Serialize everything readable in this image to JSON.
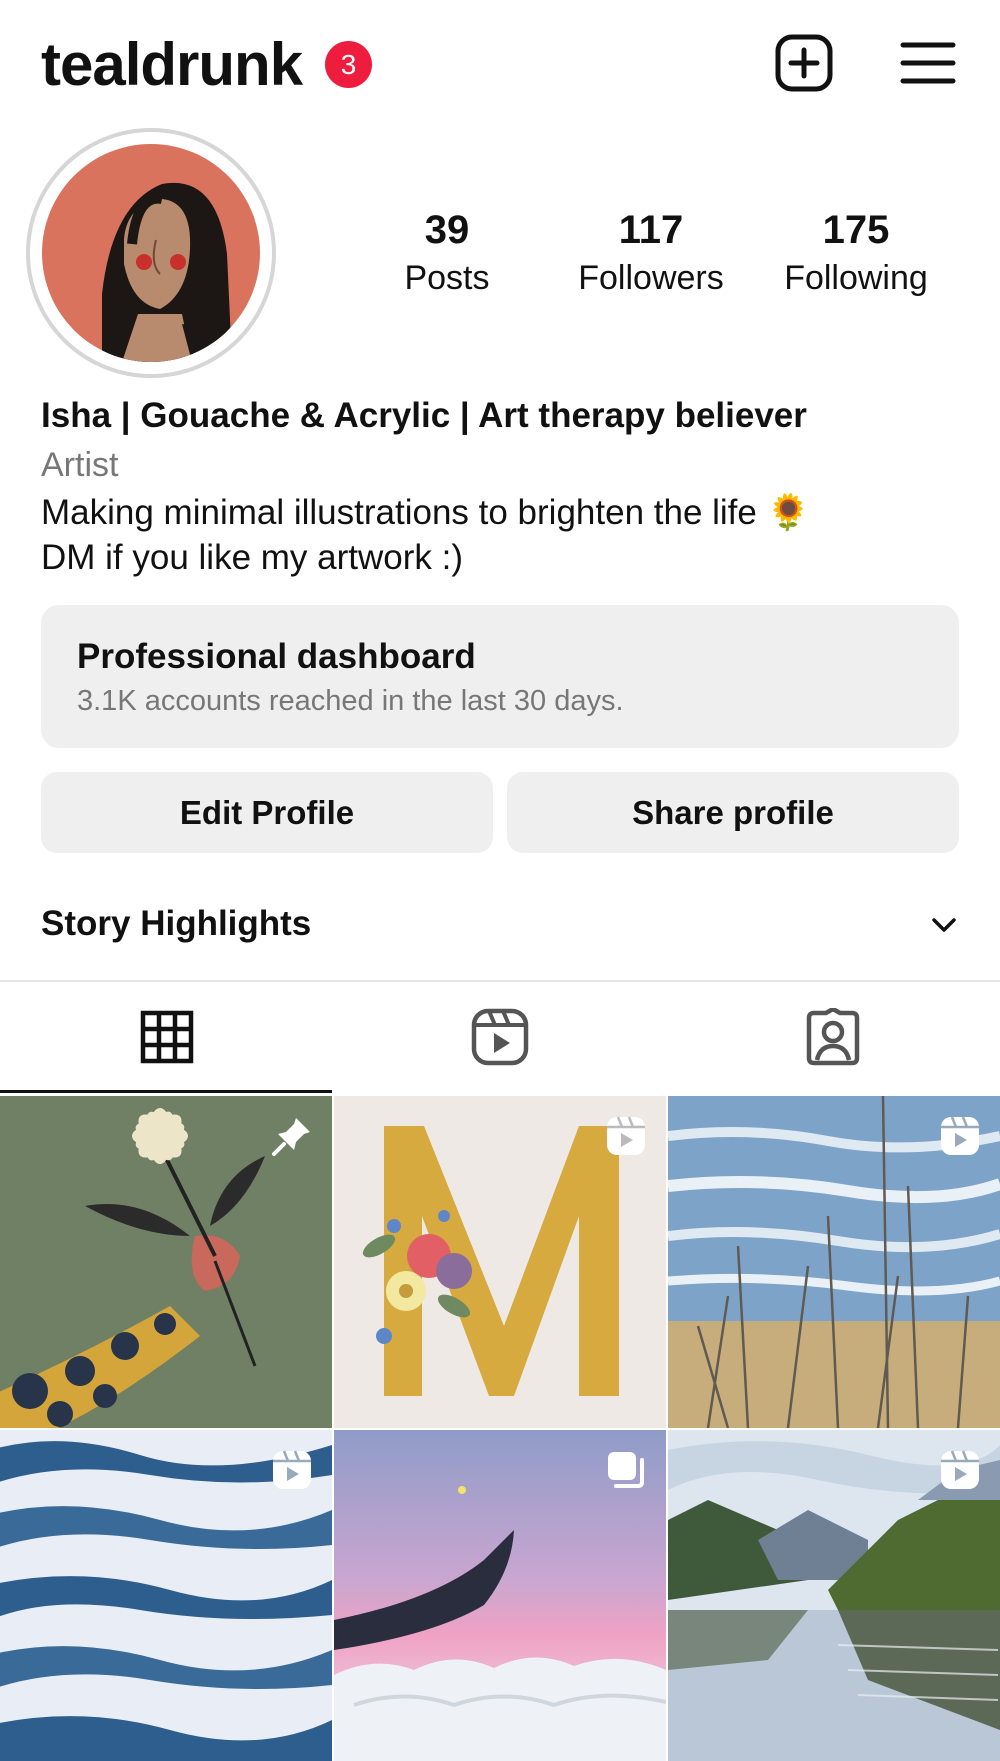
{
  "header": {
    "username": "tealdrunk",
    "notification_count": "3",
    "icons": {
      "create": "plus-square-icon",
      "menu": "hamburger-menu-icon"
    }
  },
  "stats": [
    {
      "value": "39",
      "label": "Posts"
    },
    {
      "value": "117",
      "label": "Followers"
    },
    {
      "value": "175",
      "label": "Following"
    }
  ],
  "bio": {
    "name": "Isha | Gouache & Acrylic | Art therapy believer",
    "category": "Artist",
    "lines": [
      "Making minimal illustrations to brighten the life 🌻",
      "DM if you like my artwork :)"
    ]
  },
  "dashboard": {
    "title": "Professional dashboard",
    "subtitle": "3.1K accounts reached in the last 30 days."
  },
  "buttons": {
    "edit": "Edit Profile",
    "share": "Share profile"
  },
  "highlights": {
    "title": "Story Highlights"
  },
  "tabs": [
    {
      "icon": "grid-icon",
      "active": true
    },
    {
      "icon": "reels-icon",
      "active": false
    },
    {
      "icon": "tagged-icon",
      "active": false
    }
  ],
  "posts": [
    {
      "subject": "hand with flower",
      "badge": "pin-icon"
    },
    {
      "subject": "floral letter M",
      "badge": "reel-icon"
    },
    {
      "subject": "beach grass",
      "badge": "reel-icon"
    },
    {
      "subject": "blue waves",
      "badge": "reel-icon"
    },
    {
      "subject": "pink sky",
      "badge": "carousel-icon"
    },
    {
      "subject": "mountain lake",
      "badge": "reel-icon"
    }
  ],
  "colors": {
    "badge": "#ee1d3e",
    "panel": "#efefef",
    "muted": "#777777"
  }
}
